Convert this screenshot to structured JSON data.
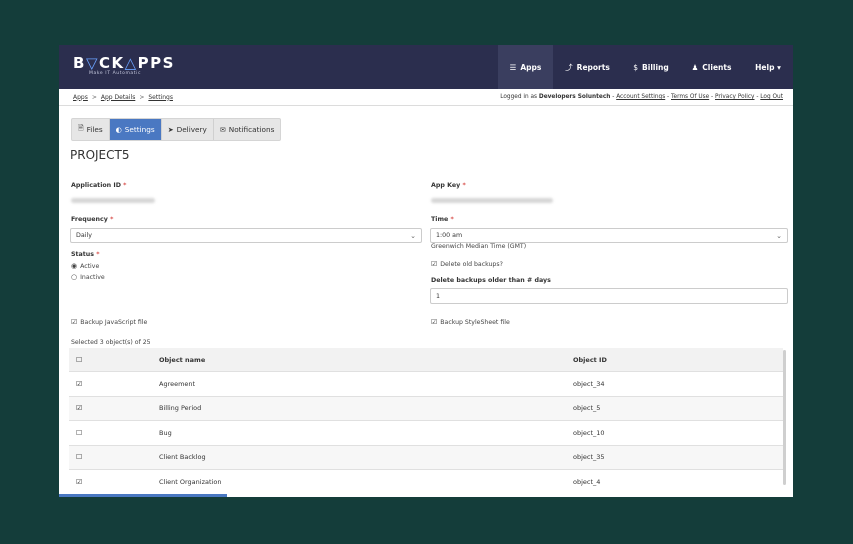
{
  "logo": {
    "text_b": "B",
    "text_ck": "CK",
    "text_pps": "PPS",
    "tagline": "Make IT Automatic"
  },
  "nav": [
    {
      "icon": "database-icon",
      "glyph": "☰",
      "label": "Apps",
      "active": true
    },
    {
      "icon": "chart-icon",
      "glyph": "⤴",
      "label": "Reports",
      "active": false
    },
    {
      "icon": "dollar-icon",
      "glyph": "$",
      "label": "Billing",
      "active": false
    },
    {
      "icon": "user-icon",
      "glyph": "♟",
      "label": "Clients",
      "active": false
    },
    {
      "icon": "help-icon",
      "glyph": "",
      "label": "Help ▾",
      "active": false
    }
  ],
  "breadcrumb": {
    "items": [
      "Apps",
      "App Details",
      "Settings"
    ],
    "sep": ">"
  },
  "account": {
    "prefix": "Logged in as",
    "company": "Developers Soluntech",
    "dash": " - ",
    "links": [
      "Account Settings",
      "Terms Of Use",
      "Privacy Policy",
      "Log Out"
    ]
  },
  "tabs": [
    {
      "name": "files",
      "glyph": "🗎",
      "label": "Files"
    },
    {
      "name": "settings",
      "glyph": "◐",
      "label": "Settings",
      "active": true
    },
    {
      "name": "delivery",
      "glyph": "➤",
      "label": "Delivery"
    },
    {
      "name": "notifications",
      "glyph": "✉",
      "label": "Notifications"
    }
  ],
  "project": {
    "title": "PROJECT5"
  },
  "form": {
    "app_id_label": "Application ID",
    "app_key_label": "App Key",
    "required_mark": "*",
    "frequency_label": "Frequency",
    "frequency_value": "Daily",
    "time_label": "Time",
    "time_value": "1:00 am",
    "timezone_note": "Greenwich Median Time (GMT)",
    "status_label": "Status",
    "status_active": "Active",
    "status_inactive": "Inactive",
    "delete_old_label": "Delete old backups?",
    "delete_days_label": "Delete backups older than # days",
    "delete_days_value": "1",
    "backup_js_label": "Backup JavaScript file",
    "backup_css_label": "Backup StyleSheet file"
  },
  "objects": {
    "summary": "Selected 3 object(s) of 25",
    "headers": [
      "Object name",
      "Object ID"
    ],
    "rows": [
      {
        "checked": true,
        "name": "Agreement",
        "id": "object_34"
      },
      {
        "checked": true,
        "name": "Billing Period",
        "id": "object_5"
      },
      {
        "checked": false,
        "name": "Bug",
        "id": "object_10"
      },
      {
        "checked": false,
        "name": "Client Backlog",
        "id": "object_35"
      },
      {
        "checked": true,
        "name": "Client Organization",
        "id": "object_4"
      }
    ]
  },
  "colors": {
    "page_bg": "#143d3a",
    "navbar": "#2b2e4e",
    "accent": "#4a78c2",
    "required": "#d9534f"
  }
}
